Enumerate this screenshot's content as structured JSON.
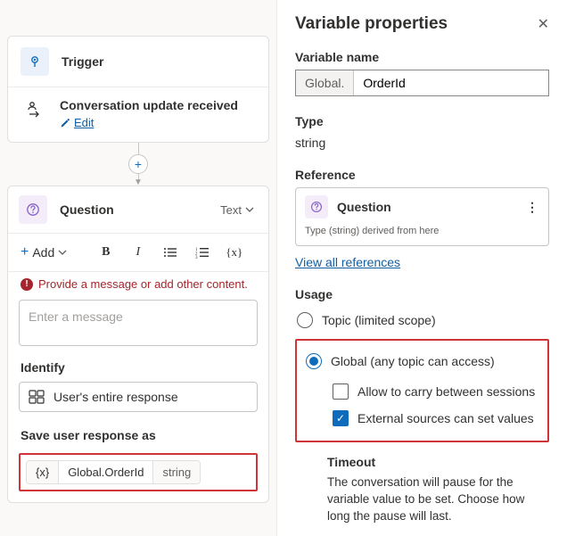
{
  "trigger": {
    "title": "Trigger",
    "event": "Conversation update received",
    "edit_label": "Edit"
  },
  "question": {
    "title": "Question",
    "type_label": "Text",
    "toolbar": {
      "add_label": "Add"
    },
    "error_msg": "Provide a message or add other content.",
    "msg_placeholder": "Enter a message",
    "identify_label": "Identify",
    "identify_value": "User's entire response",
    "save_label": "Save user response as",
    "save_chip": {
      "var": "Global.OrderId",
      "type": "string"
    }
  },
  "panel": {
    "title": "Variable properties",
    "varname_label": "Variable name",
    "varname_prefix": "Global.",
    "varname_value": "OrderId",
    "type_label": "Type",
    "type_value": "string",
    "reference_label": "Reference",
    "reference_card": {
      "title": "Question",
      "sub": "Type (string) derived from here"
    },
    "view_all": "View all references",
    "usage_label": "Usage",
    "opt_topic": "Topic (limited scope)",
    "opt_global": "Global (any topic can access)",
    "opt_carry": "Allow to carry between sessions",
    "opt_external": "External sources can set values",
    "timeout_label": "Timeout",
    "timeout_desc": "The conversation will pause for the variable value to be set. Choose how long the pause will last."
  }
}
